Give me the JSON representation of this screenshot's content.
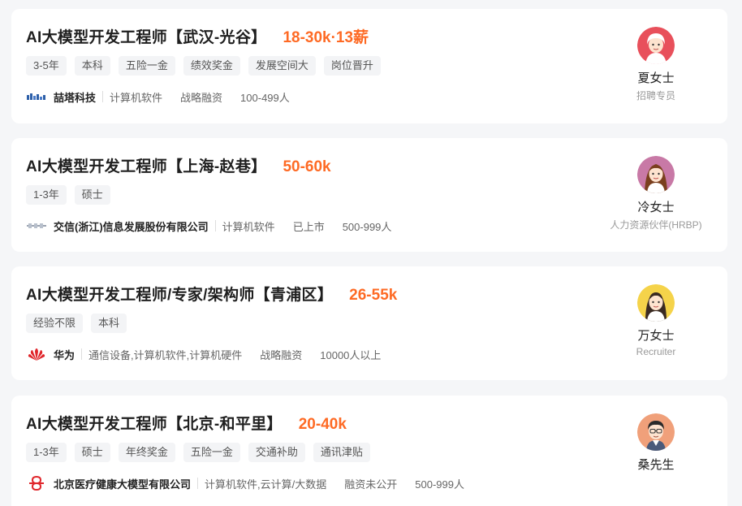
{
  "jobs": [
    {
      "title": "AI大模型开发工程师【武汉-光谷】",
      "salary": "18-30k·13薪",
      "tags": [
        "3-5年",
        "本科",
        "五险一金",
        "绩效奖金",
        "发展空间大",
        "岗位晋升"
      ],
      "company": "喆塔科技",
      "meta": [
        "计算机软件",
        "战略融资",
        "100-499人"
      ],
      "recruiter_name": "夏女士",
      "recruiter_role": "招聘专员",
      "avatar_bg": "#e8505b"
    },
    {
      "title": "AI大模型开发工程师【上海-赵巷】",
      "salary": "50-60k",
      "tags": [
        "1-3年",
        "硕士"
      ],
      "company": "交信(浙江)信息发展股份有限公司",
      "meta": [
        "计算机软件",
        "已上市",
        "500-999人"
      ],
      "recruiter_name": "冷女士",
      "recruiter_role": "人力资源伙伴(HRBP)",
      "avatar_bg": "#c879a6"
    },
    {
      "title": "AI大模型开发工程师/专家/架构师【青浦区】",
      "salary": "26-55k",
      "tags": [
        "经验不限",
        "本科"
      ],
      "company": "华为",
      "meta": [
        "通信设备,计算机软件,计算机硬件",
        "战略融资",
        "10000人以上"
      ],
      "recruiter_name": "万女士",
      "recruiter_role": "Recruiter",
      "avatar_bg": "#f5d34a"
    },
    {
      "title": "AI大模型开发工程师【北京-和平里】",
      "salary": "20-40k",
      "tags": [
        "1-3年",
        "硕士",
        "年终奖金",
        "五险一金",
        "交通补助",
        "通讯津贴"
      ],
      "company": "北京医疗健康大模型有限公司",
      "meta": [
        "计算机软件,云计算/大数据",
        "融资未公开",
        "500-999人"
      ],
      "recruiter_name": "桑先生",
      "recruiter_role": "",
      "avatar_bg": "#f0a07a"
    }
  ],
  "colors": {
    "salary": "#fe6a24",
    "background": "#f5f6f8"
  }
}
